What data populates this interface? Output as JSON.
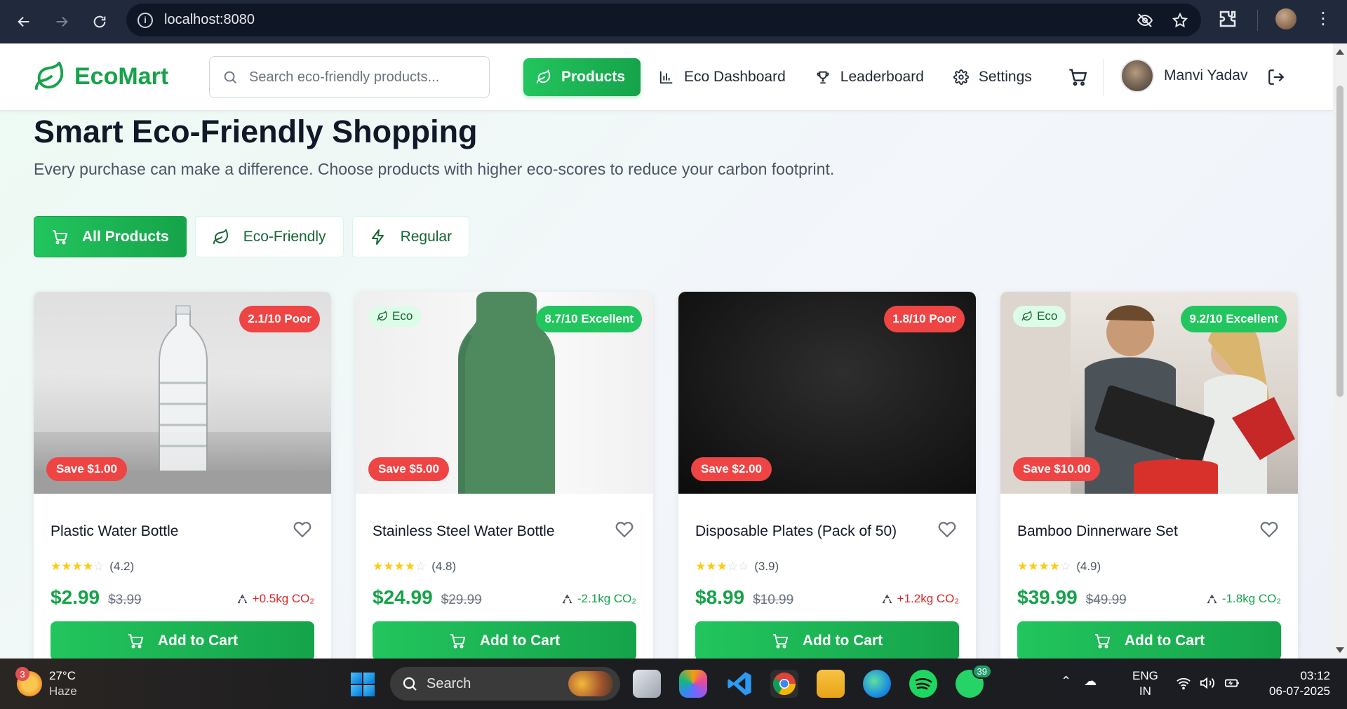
{
  "browser": {
    "url": "localhost:8080"
  },
  "header": {
    "brand": "EcoMart",
    "search_placeholder": "Search eco-friendly products...",
    "nav": [
      {
        "label": "Products",
        "icon": "leaf-icon",
        "active": true
      },
      {
        "label": "Eco Dashboard",
        "icon": "bar-chart-icon",
        "active": false
      },
      {
        "label": "Leaderboard",
        "icon": "trophy-icon",
        "active": false
      },
      {
        "label": "Settings",
        "icon": "gear-icon",
        "active": false
      }
    ],
    "user_name": "Manvi Yadav"
  },
  "hero": {
    "title": "Smart Eco-Friendly Shopping",
    "subtitle": "Every purchase can make a difference. Choose products with higher eco-scores to reduce your carbon footprint."
  },
  "filters": [
    {
      "label": "All Products",
      "icon": "cart-icon",
      "active": true
    },
    {
      "label": "Eco-Friendly",
      "icon": "leaf-icon",
      "active": false
    },
    {
      "label": "Regular",
      "icon": "bolt-icon",
      "active": false
    }
  ],
  "products": [
    {
      "name": "Plastic Water Bottle",
      "eco_score": "2.1/10 Poor",
      "eco_tag": "",
      "save": "Save $1.00",
      "rating_text": "(4.2)",
      "stars": 4,
      "price": "$2.99",
      "old_price": "$3.99",
      "co2": "+0.5kg CO₂",
      "co2_status": "bad",
      "cta": "Add to Cart"
    },
    {
      "name": "Stainless Steel Water Bottle",
      "eco_score": "8.7/10 Excellent",
      "eco_tag": "Eco",
      "save": "Save $5.00",
      "rating_text": "(4.8)",
      "stars": 4,
      "price": "$24.99",
      "old_price": "$29.99",
      "co2": "-2.1kg CO₂",
      "co2_status": "good",
      "cta": "Add to Cart"
    },
    {
      "name": "Disposable Plates (Pack of 50)",
      "eco_score": "1.8/10 Poor",
      "eco_tag": "",
      "save": "Save $2.00",
      "rating_text": "(3.9)",
      "stars": 3,
      "price": "$8.99",
      "old_price": "$10.99",
      "co2": "+1.2kg CO₂",
      "co2_status": "bad",
      "cta": "Add to Cart"
    },
    {
      "name": "Bamboo Dinnerware Set",
      "eco_score": "9.2/10 Excellent",
      "eco_tag": "Eco",
      "save": "Save $10.00",
      "rating_text": "(4.9)",
      "stars": 4,
      "price": "$39.99",
      "old_price": "$49.99",
      "co2": "-1.8kg CO₂",
      "co2_status": "good",
      "cta": "Add to Cart"
    }
  ],
  "taskbar": {
    "weather_temp": "27°C",
    "weather_desc": "Haze",
    "weather_badge": "3",
    "search_label": "Search",
    "whatsapp_badge": "39",
    "lang_line1": "ENG",
    "lang_line2": "IN",
    "time": "03:12",
    "date": "06-07-2025"
  },
  "colors": {
    "brand_green": "#16a34a",
    "poor_red": "#ef4444",
    "excellent_green": "#22c55e"
  }
}
